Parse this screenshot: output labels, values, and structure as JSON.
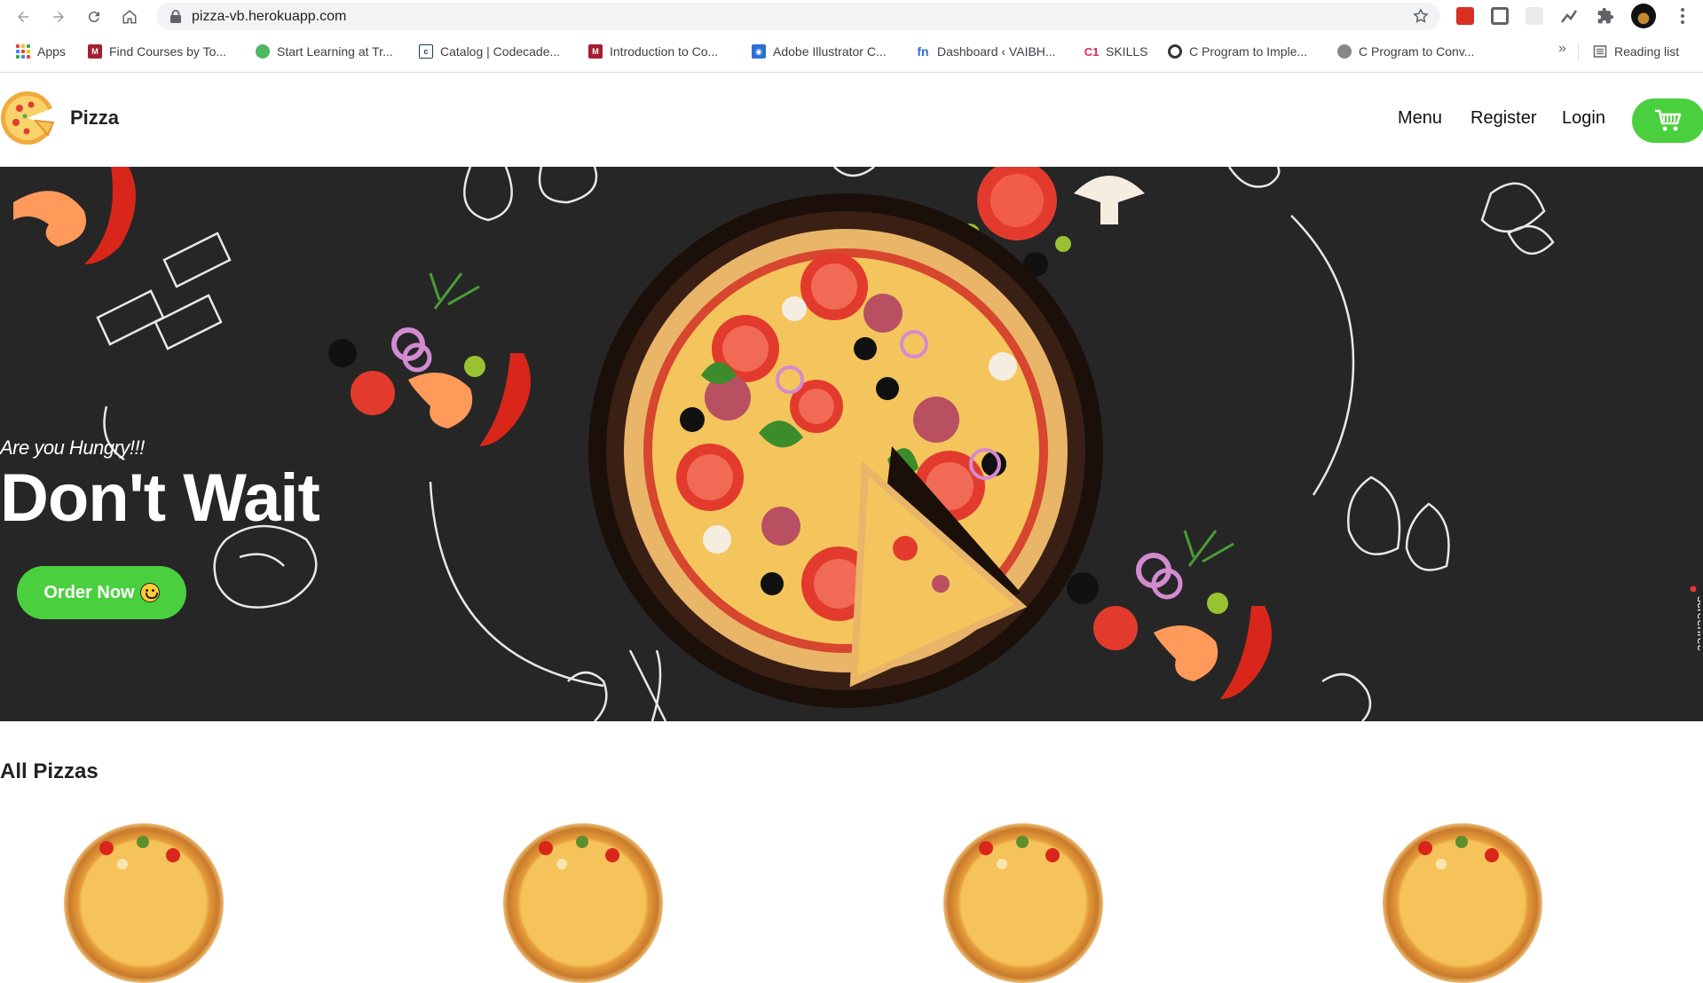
{
  "browser": {
    "url": "pizza-vb.herokuapp.com",
    "bookmarks": [
      {
        "label": "Apps"
      },
      {
        "label": "Find Courses by To..."
      },
      {
        "label": "Start Learning at Tr..."
      },
      {
        "label": "Catalog | Codecade..."
      },
      {
        "label": "Introduction to Co..."
      },
      {
        "label": "Adobe Illustrator C..."
      },
      {
        "label": "Dashboard ‹ VAIBH..."
      },
      {
        "label": "SKILLS"
      },
      {
        "label": "C Program to Imple..."
      },
      {
        "label": "C Program to Conv..."
      }
    ],
    "more": "»",
    "reading_list": "Reading list"
  },
  "header": {
    "brand": "Pizza",
    "nav": {
      "menu": "Menu",
      "register": "Register",
      "login": "Login"
    }
  },
  "hero": {
    "tagline": "Are you Hungry!!!",
    "title": "Don't Wait",
    "cta": "Order Now"
  },
  "recorder": "screenrec",
  "section": {
    "title": "All Pizzas"
  },
  "colors": {
    "accent": "#4ad03e",
    "hero_bg": "#262626"
  }
}
